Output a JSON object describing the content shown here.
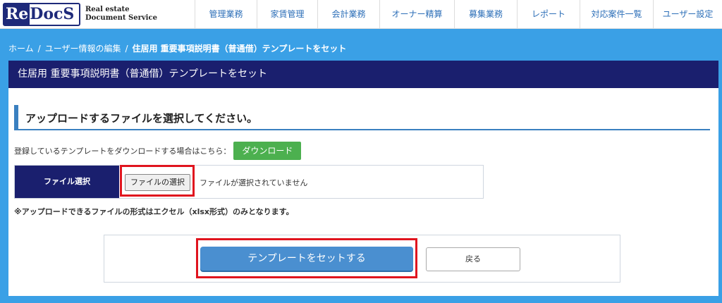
{
  "logo": {
    "mark_re": "Re",
    "mark_docs": "DocS",
    "sub_line1": "Real estate",
    "sub_line2": "Document Service"
  },
  "nav": {
    "items": [
      {
        "label": "管理業務"
      },
      {
        "label": "家賃管理"
      },
      {
        "label": "会計業務"
      },
      {
        "label": "オーナー精算"
      },
      {
        "label": "募集業務"
      },
      {
        "label": "レポート"
      },
      {
        "label": "対応案件一覧"
      },
      {
        "label": "ユーザー設定"
      }
    ]
  },
  "breadcrumb": {
    "home": "ホーム",
    "sep": "/",
    "parent": "ユーザー情報の編集",
    "current": "住居用 重要事項説明書（普通借）テンプレートをセット"
  },
  "page": {
    "title": "住居用 重要事項説明書（普通借）テンプレートをセット"
  },
  "upload": {
    "section_title": "アップロードするファイルを選択してください。",
    "download_text": "登録しているテンプレートをダウンロードする場合はこちら：",
    "download_button": "ダウンロード",
    "file_label": "ファイル選択",
    "file_button": "ファイルの選択",
    "file_status": "ファイルが選択されていません",
    "note": "※アップロードできるファイルの形式はエクセル（xlsx形式）のみとなります。"
  },
  "actions": {
    "submit": "テンプレートをセットする",
    "back": "戻る"
  },
  "colors": {
    "background": "#3aa0e6",
    "title_bar": "#1a1f6e",
    "accent": "#3a80c0",
    "download_green": "#4cb04f",
    "primary_blue": "#4a8fd0",
    "highlight_red": "#e0141e"
  }
}
